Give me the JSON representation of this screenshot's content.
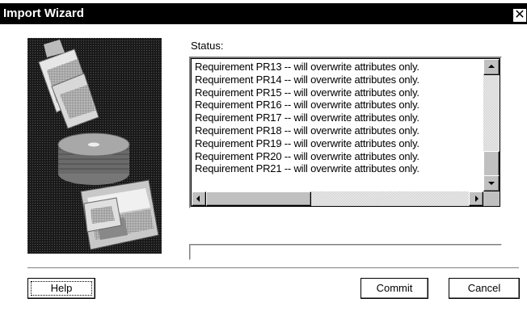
{
  "window": {
    "title": "Import Wizard",
    "close_label": "✕"
  },
  "status": {
    "label": "Status:",
    "rows": [
      "Requirement PR13 --  will overwrite attributes only.",
      "Requirement PR14 --  will overwrite attributes only.",
      "Requirement PR15 --  will overwrite attributes only.",
      "Requirement PR16 --  will overwrite attributes only.",
      "Requirement PR17 --  will overwrite attributes only.",
      "Requirement PR18 --  will overwrite attributes only.",
      "Requirement PR19 --  will overwrite attributes only.",
      "Requirement PR20 --  will overwrite attributes only.",
      "Requirement PR21 --  will overwrite attributes only."
    ]
  },
  "progress": {
    "fraction": 0
  },
  "buttons": {
    "help": "Help",
    "commit": "Commit",
    "cancel": "Cancel"
  },
  "colors": {
    "titlebar": "#000000",
    "face": "#c0c0c0",
    "window": "#ffffff"
  },
  "icons": {
    "close": "close-icon",
    "up": "scroll-up-arrow-icon",
    "down": "scroll-down-arrow-icon",
    "left": "scroll-left-arrow-icon",
    "right": "scroll-right-arrow-icon"
  }
}
